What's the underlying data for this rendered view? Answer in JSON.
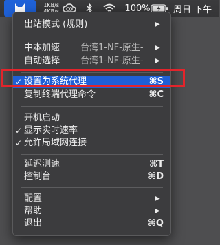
{
  "menubar": {
    "clash_icon": "clash-cat-icon",
    "upload_speed": "1KB/s",
    "download_speed": "4KB/s",
    "creative_cloud_icon": "creative-cloud-icon",
    "bluetooth_icon": "bluetooth-icon",
    "bluetooth_glyph": "✱",
    "wifi_icon": "wifi-icon",
    "battery_percent": "100%",
    "battery_icon": "battery-charging-icon",
    "datetime": "周日 下午"
  },
  "menu": {
    "outbound_mode": "出站模式 (规则)",
    "relay": "中本加速",
    "relay_value": "台湾1-NF-原生-",
    "auto_select": "自动选择",
    "auto_select_value": "台湾1-NF-原生-",
    "set_system_proxy": "设置为系统代理",
    "set_system_proxy_shortcut": "⌘S",
    "copy_terminal": "复制终端代理命令",
    "copy_terminal_shortcut": "⌘C",
    "launch_at_login": "开机启动",
    "show_speed": "显示实时速率",
    "allow_lan": "允许局域网连接",
    "latency_test": "延迟测速",
    "latency_test_shortcut": "⌘T",
    "dashboard": "控制台",
    "dashboard_shortcut": "⌘D",
    "config": "配置",
    "help": "帮助",
    "quit": "退出",
    "quit_shortcut": "⌘Q",
    "check_glyph": "✓",
    "arrow_glyph": "▶"
  },
  "colors": {
    "highlight": "#1f5fd6",
    "annotation_box": "#e3242b",
    "menu_bg": "#3c3c3e"
  }
}
